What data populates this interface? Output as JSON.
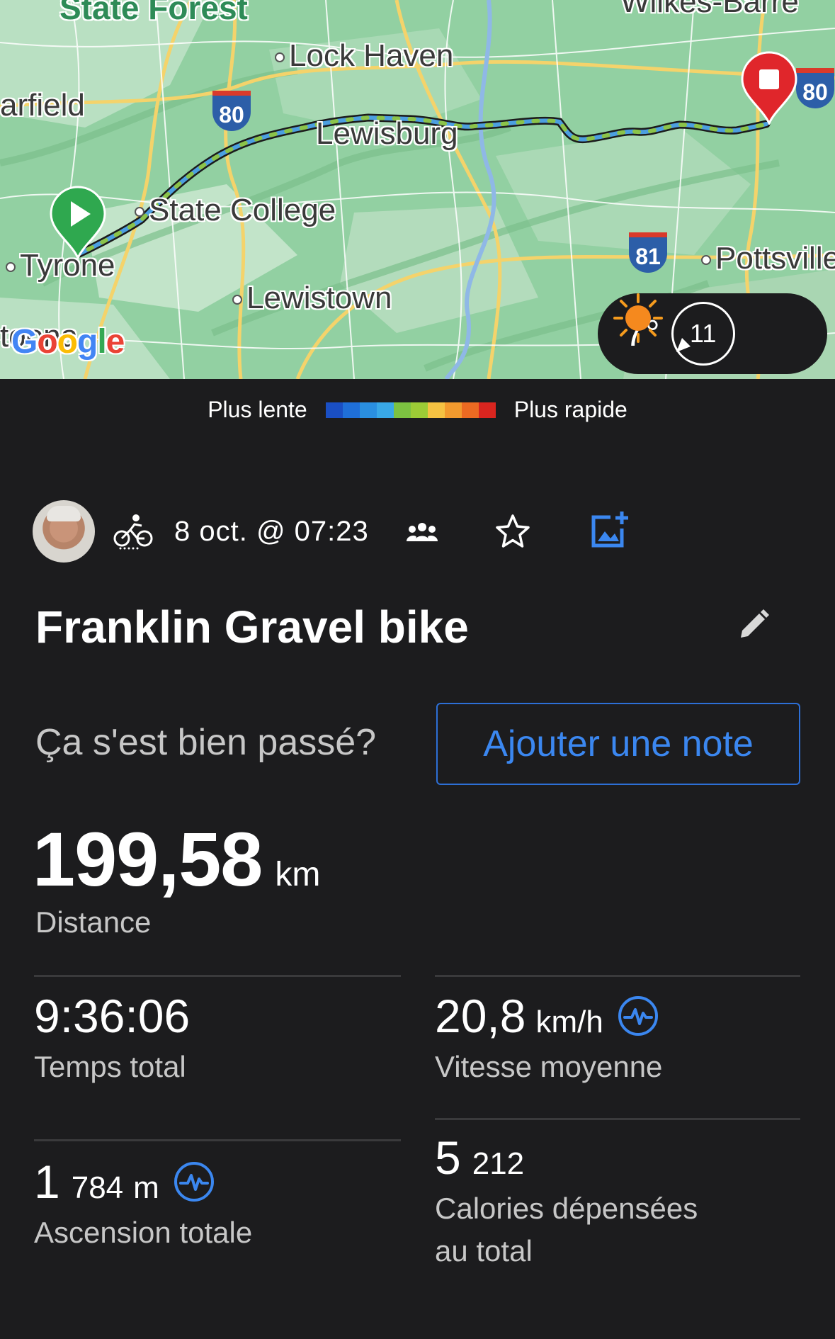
{
  "map": {
    "places": {
      "state_forest": "State Forest",
      "wilkes_barre": "Wilkes-Barre",
      "lock_haven": "Lock Haven",
      "garfield": "arfield",
      "lewisburg": "Lewisburg",
      "state_college": "State College",
      "tyrone": "Tyrone",
      "lewistown": "Lewistown",
      "pottsville": "Pottsville",
      "toona": "toona"
    },
    "shields": {
      "i80_left": "80",
      "i80_right": "80",
      "i81": "81"
    },
    "google": "Google",
    "start_icon": "play-marker-icon",
    "end_icon": "stop-marker-icon"
  },
  "weather": {
    "temperature": "7°",
    "condition_icon": "sun-icon",
    "wind_speed": "11"
  },
  "legend": {
    "slow": "Plus lente",
    "fast": "Plus rapide",
    "colors": [
      "#1a4fc4",
      "#1f6fd8",
      "#2a8fe0",
      "#39a8e6",
      "#7cc241",
      "#9ccb36",
      "#f5c242",
      "#f29a2e",
      "#ec6a22",
      "#d9251f"
    ]
  },
  "activity": {
    "date": "8 oct. @ 07:23",
    "title": "Franklin Gravel bike",
    "prompt": "Ça s'est bien passé?",
    "note_button": "Ajouter une note"
  },
  "stats": {
    "distance": {
      "value": "199,58",
      "unit": "km",
      "label": "Distance"
    },
    "time": {
      "value": "9:36:06",
      "label": "Temps total"
    },
    "speed": {
      "value": "20,8",
      "unit": "km/h",
      "label": "Vitesse moyenne"
    },
    "ascent": {
      "value": "1",
      "value_rest": "784",
      "unit": "m",
      "label": "Ascension totale"
    },
    "calories": {
      "value": "5",
      "value_rest": "212",
      "label_line1": "Calories dépensées",
      "label_line2": "au total"
    }
  },
  "colors": {
    "accent": "#3b87f0",
    "background": "#1c1c1e",
    "muted_text": "#c7c7c7",
    "start_marker": "#2fa84f",
    "end_marker": "#e0262b"
  }
}
